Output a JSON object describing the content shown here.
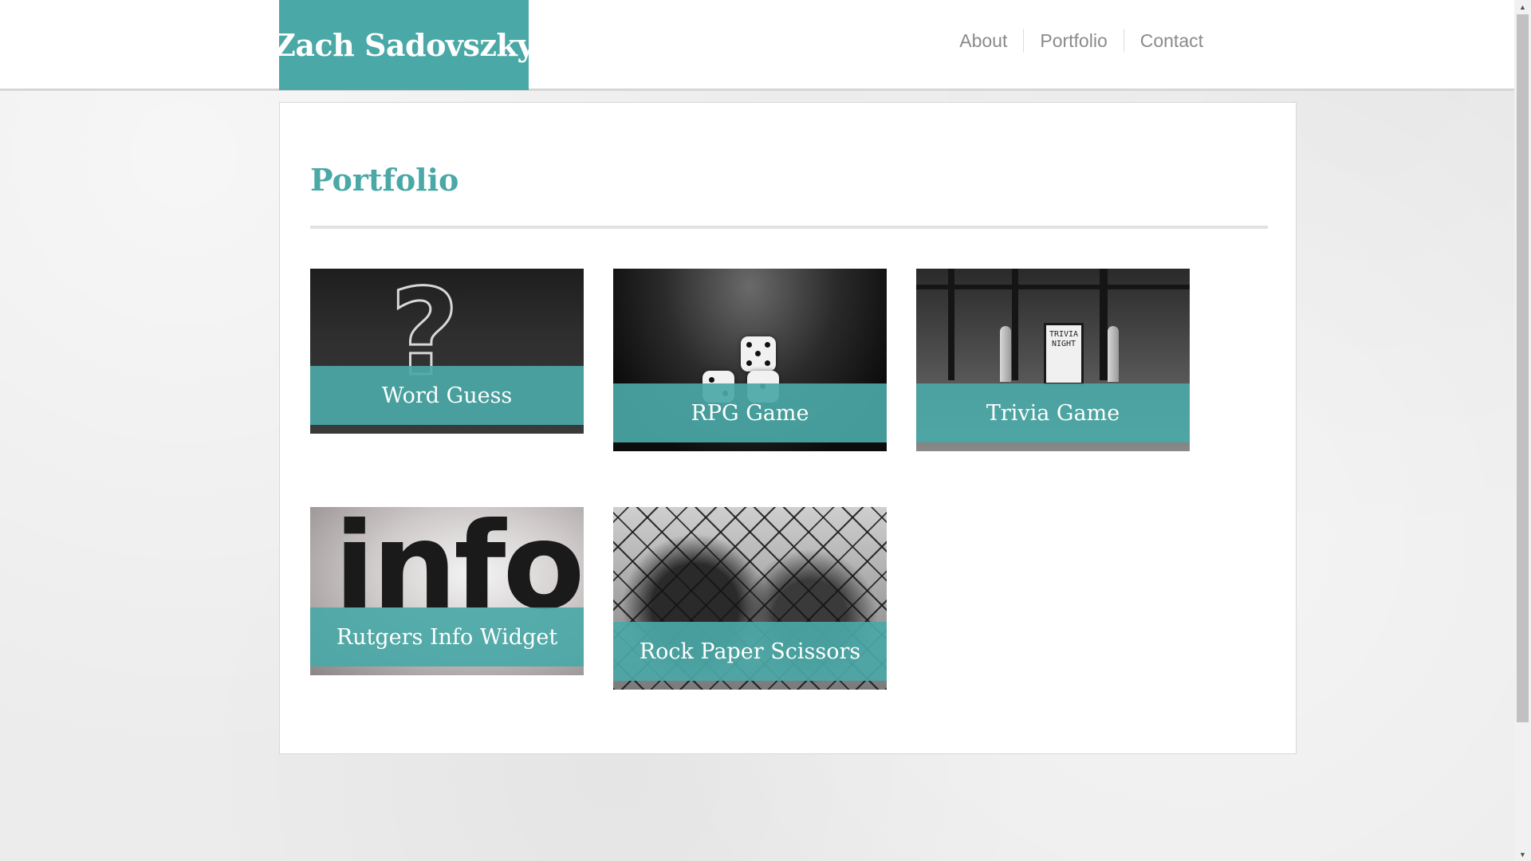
{
  "header": {
    "brand": "Zach Sadovszky",
    "nav": [
      {
        "label": "About"
      },
      {
        "label": "Portfolio"
      },
      {
        "label": "Contact"
      }
    ]
  },
  "main": {
    "title": "Portfolio",
    "projects": [
      {
        "label": "Word Guess",
        "image": "chalkboard-question-mark"
      },
      {
        "label": "RPG Game",
        "image": "dice"
      },
      {
        "label": "Trivia Game",
        "image": "trivia-night-sign"
      },
      {
        "label": "Rutgers Info Widget",
        "image": "info-text"
      },
      {
        "label": "Rock Paper Scissors",
        "image": "chain-link-fence"
      }
    ]
  },
  "trivia_sign_text": "TRIVIA NIGHT",
  "info_image_text": "info",
  "colors": {
    "accent": "#4aa8a6",
    "nav_text": "#8a8a8a",
    "page_background": "#ececec"
  },
  "icons": {
    "scroll_up": "triangle-up-icon",
    "scroll_down": "triangle-down-icon"
  }
}
